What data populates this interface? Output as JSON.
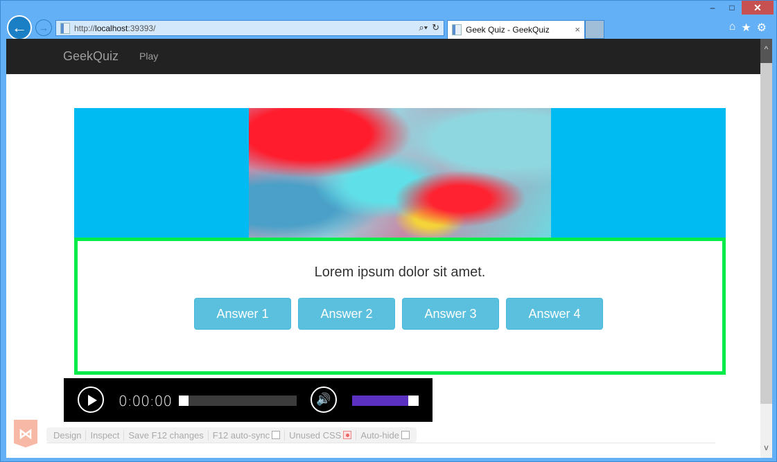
{
  "window": {
    "controls": {
      "minimize": "–",
      "maximize": "□",
      "close": "✕"
    }
  },
  "browser": {
    "url_prefix": "http://",
    "url_host": "localhost",
    "url_suffix": ":39393/",
    "tab_title": "Geek Quiz - GeekQuiz",
    "tab_close": "×",
    "back_glyph": "←",
    "forward_glyph": "→",
    "search_glyph": "⌕▾",
    "refresh_glyph": "↻",
    "tools": {
      "home": "⌂",
      "favorites": "★",
      "settings": "⚙"
    }
  },
  "navbar": {
    "brand": "GeekQuiz",
    "links": [
      {
        "label": "Play"
      }
    ]
  },
  "quiz": {
    "question": "Lorem ipsum dolor sit amet.",
    "answers": [
      {
        "label": "Answer 1"
      },
      {
        "label": "Answer 2"
      },
      {
        "label": "Answer 3"
      },
      {
        "label": "Answer 4"
      }
    ],
    "colors": {
      "hero_bg": "#00bbf2",
      "card_border": "#03ec4a",
      "answer_bg": "#5bc0de"
    }
  },
  "player": {
    "time": "0:00:00",
    "seek_progress": 0.0,
    "volume_level": 0.84,
    "volume_glyph": "🔊",
    "colors": {
      "volume_fill": "#5b31c2"
    }
  },
  "browser_link_toolbar": {
    "logo_glyph": "⋈",
    "items": [
      {
        "label": "Design"
      },
      {
        "label": "Inspect"
      },
      {
        "label": "Save F12 changes"
      },
      {
        "label": "F12 auto-sync",
        "checked": false
      },
      {
        "label": "Unused CSS",
        "active": true
      },
      {
        "label": "Auto-hide",
        "checked": false
      }
    ]
  },
  "scrollbar": {
    "up_glyph": "^",
    "down_glyph": "v"
  }
}
